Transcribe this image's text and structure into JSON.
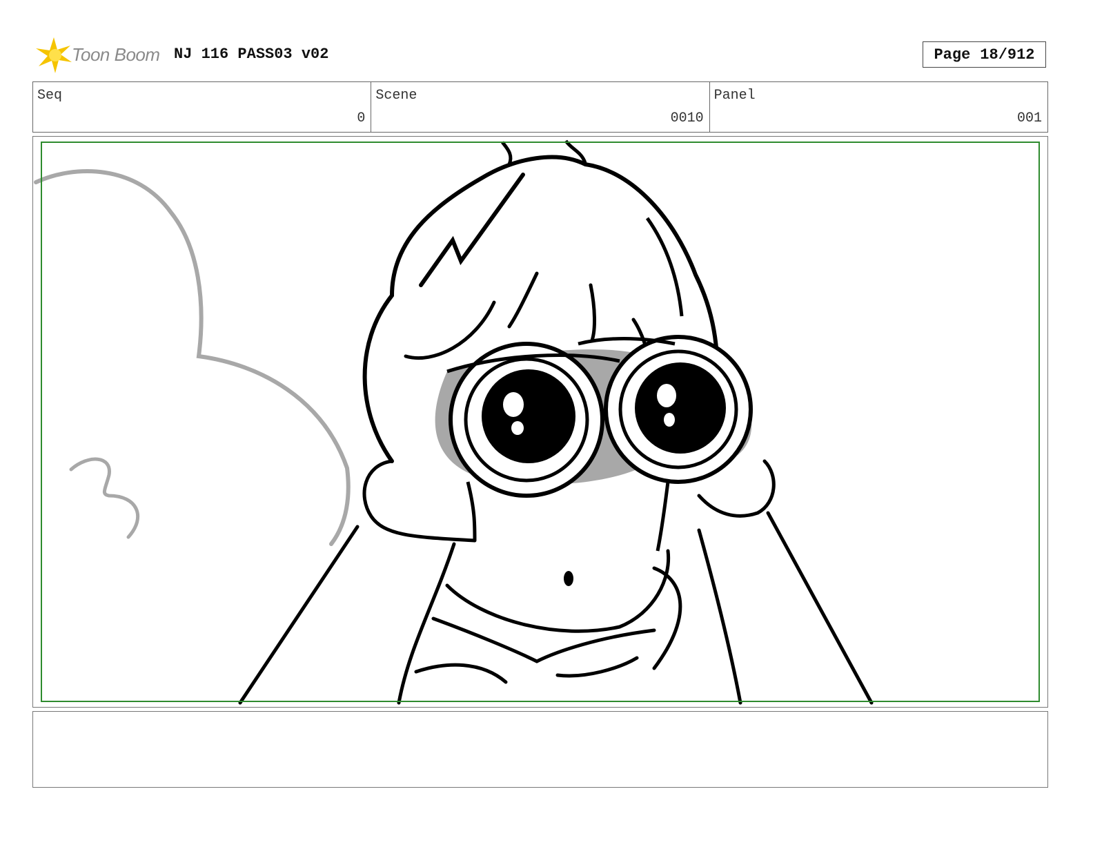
{
  "header": {
    "logo_text": "Toon Boom",
    "doc_title": "NJ 116 PASS03 v02",
    "page_label": "Page",
    "page_number": "18/912"
  },
  "info": {
    "seq_label": "Seq",
    "seq_value": "0",
    "scene_label": "Scene",
    "scene_value": "0010",
    "panel_label": "Panel",
    "panel_value": "001"
  },
  "colors": {
    "safe_frame": "#2e8b2e",
    "logo_star": "#f5c400",
    "ink": "#000000",
    "shade": "#a8a8a8"
  },
  "notes": {
    "text": ""
  }
}
